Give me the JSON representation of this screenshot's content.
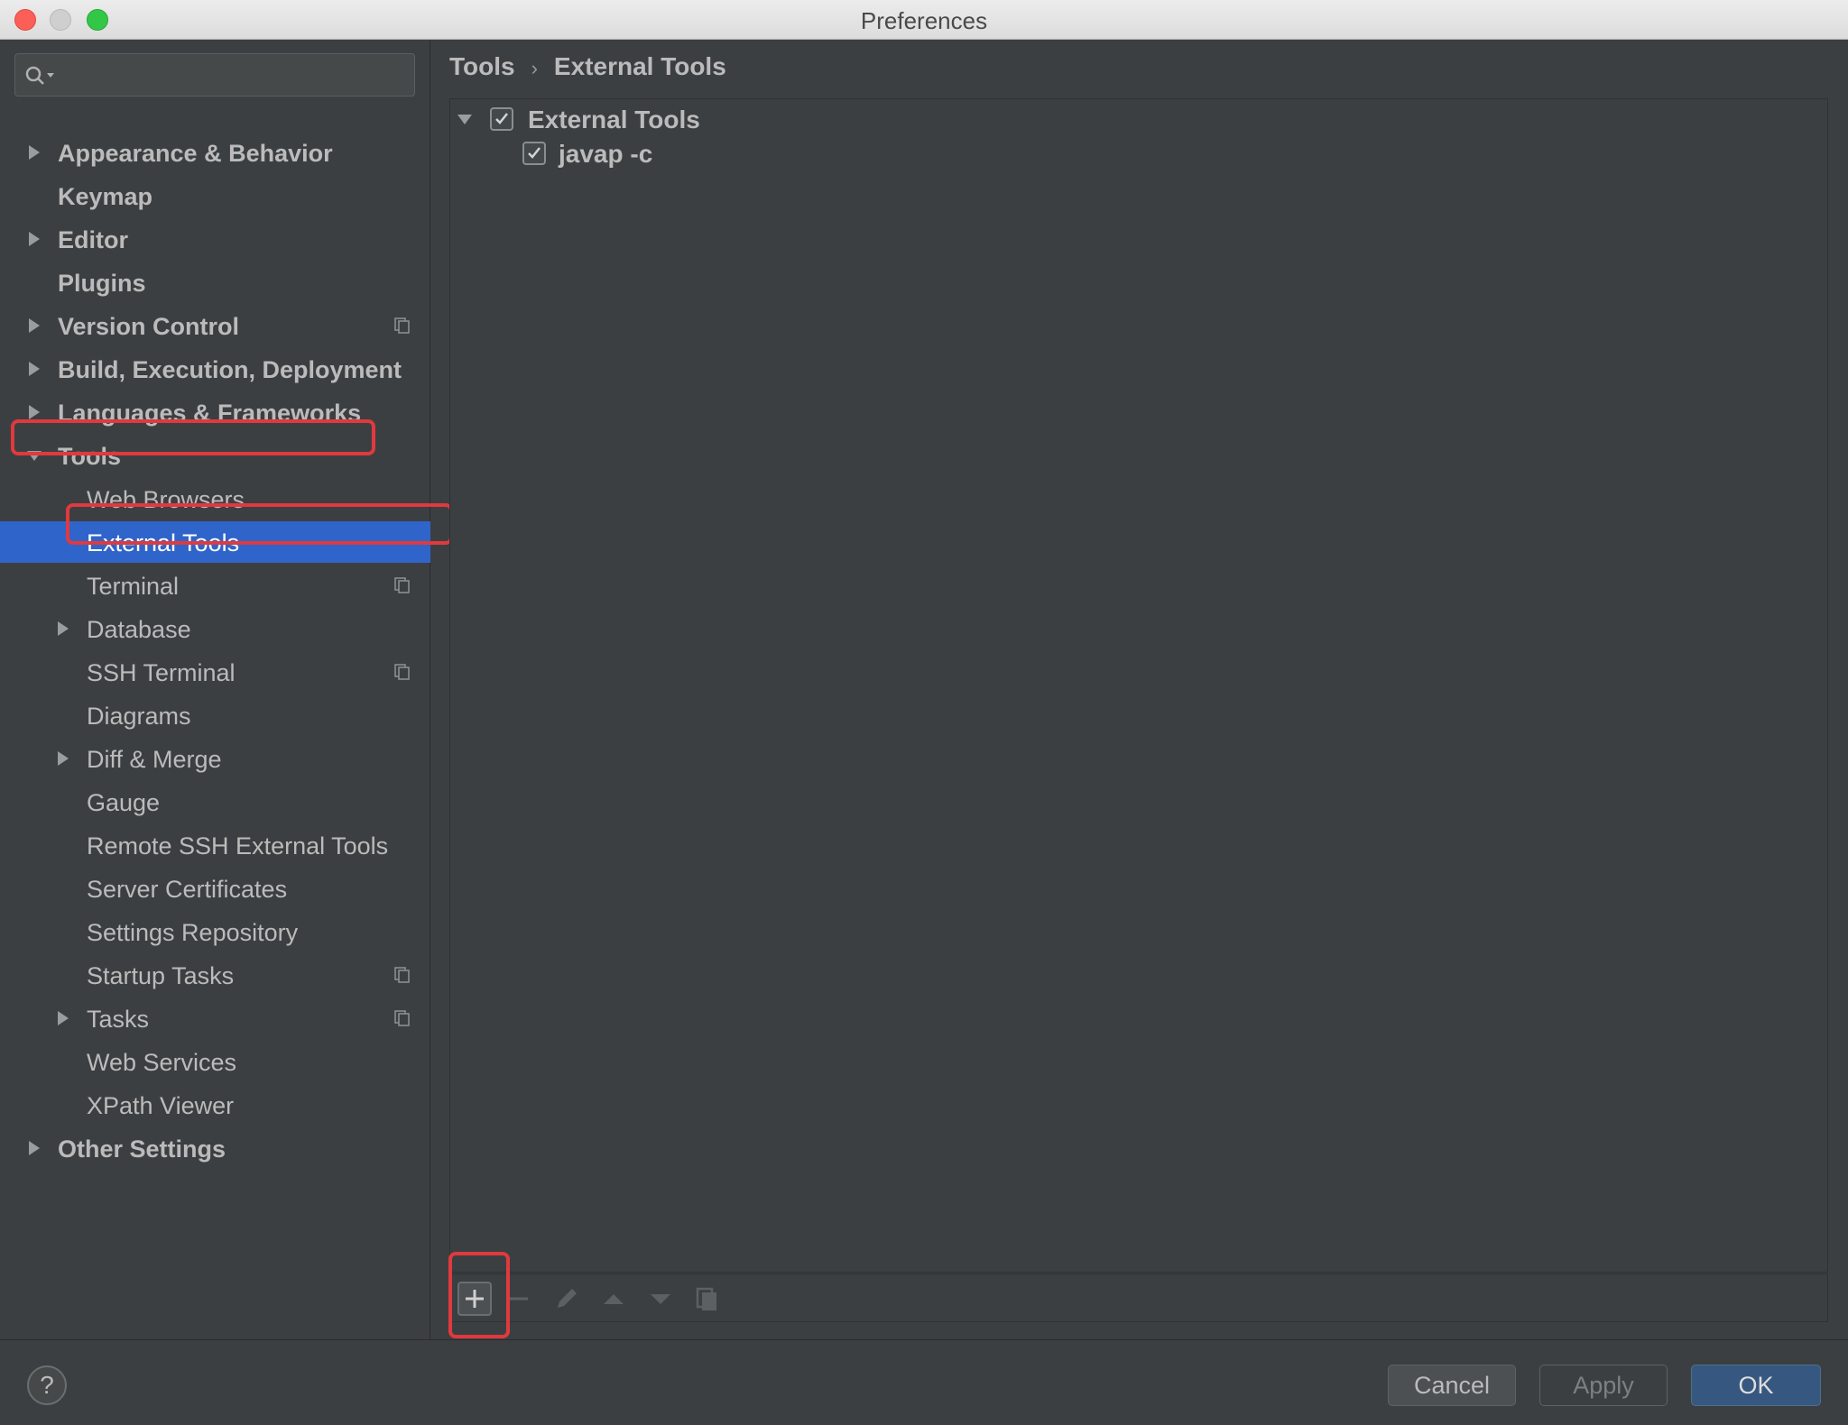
{
  "window": {
    "title": "Preferences"
  },
  "search": {
    "placeholder": ""
  },
  "sidebar": {
    "items": [
      {
        "label": "Appearance & Behavior",
        "level": 0,
        "expandable": true,
        "expanded": false,
        "copy_icon": false
      },
      {
        "label": "Keymap",
        "level": 0,
        "expandable": false,
        "copy_icon": false
      },
      {
        "label": "Editor",
        "level": 0,
        "expandable": true,
        "expanded": false,
        "copy_icon": false
      },
      {
        "label": "Plugins",
        "level": 0,
        "expandable": false,
        "copy_icon": false
      },
      {
        "label": "Version Control",
        "level": 0,
        "expandable": true,
        "expanded": false,
        "copy_icon": true
      },
      {
        "label": "Build, Execution, Deployment",
        "level": 0,
        "expandable": true,
        "expanded": false,
        "copy_icon": false
      },
      {
        "label": "Languages & Frameworks",
        "level": 0,
        "expandable": true,
        "expanded": false,
        "copy_icon": false
      },
      {
        "label": "Tools",
        "level": 0,
        "expandable": true,
        "expanded": true,
        "copy_icon": false,
        "highlighted": true
      },
      {
        "label": "Web Browsers",
        "level": 1,
        "expandable": false,
        "copy_icon": false
      },
      {
        "label": "External Tools",
        "level": 1,
        "expandable": false,
        "copy_icon": false,
        "selected": true,
        "highlighted": true
      },
      {
        "label": "Terminal",
        "level": 1,
        "expandable": false,
        "copy_icon": true
      },
      {
        "label": "Database",
        "level": 1,
        "expandable": true,
        "expanded": false,
        "copy_icon": false
      },
      {
        "label": "SSH Terminal",
        "level": 1,
        "expandable": false,
        "copy_icon": true
      },
      {
        "label": "Diagrams",
        "level": 1,
        "expandable": false,
        "copy_icon": false
      },
      {
        "label": "Diff & Merge",
        "level": 1,
        "expandable": true,
        "expanded": false,
        "copy_icon": false
      },
      {
        "label": "Gauge",
        "level": 1,
        "expandable": false,
        "copy_icon": false
      },
      {
        "label": "Remote SSH External Tools",
        "level": 1,
        "expandable": false,
        "copy_icon": false
      },
      {
        "label": "Server Certificates",
        "level": 1,
        "expandable": false,
        "copy_icon": false
      },
      {
        "label": "Settings Repository",
        "level": 1,
        "expandable": false,
        "copy_icon": false
      },
      {
        "label": "Startup Tasks",
        "level": 1,
        "expandable": false,
        "copy_icon": true
      },
      {
        "label": "Tasks",
        "level": 1,
        "expandable": true,
        "expanded": false,
        "copy_icon": true
      },
      {
        "label": "Web Services",
        "level": 1,
        "expandable": false,
        "copy_icon": false
      },
      {
        "label": "XPath Viewer",
        "level": 1,
        "expandable": false,
        "copy_icon": false
      },
      {
        "label": "Other Settings",
        "level": 0,
        "expandable": true,
        "expanded": false,
        "copy_icon": false
      }
    ]
  },
  "breadcrumb": {
    "parent": "Tools",
    "separator": "›",
    "current": "External Tools"
  },
  "tree": {
    "group": {
      "label": "External Tools",
      "checked": true,
      "expanded": true
    },
    "children": [
      {
        "label": "javap -c",
        "checked": true
      }
    ]
  },
  "toolbar": {
    "buttons": [
      "plus-icon",
      "minus-icon",
      "pencil-icon",
      "arrow-up-icon",
      "arrow-down-icon",
      "copy-icon"
    ],
    "add_highlighted": true
  },
  "footer": {
    "help_label": "?",
    "cancel_label": "Cancel",
    "apply_label": "Apply",
    "ok_label": "OK"
  },
  "colors": {
    "background": "#3c3f41",
    "selection": "#2f65ca",
    "highlight_box": "#e0393e",
    "ok_button": "#365880",
    "text": "#bbbbbb"
  }
}
